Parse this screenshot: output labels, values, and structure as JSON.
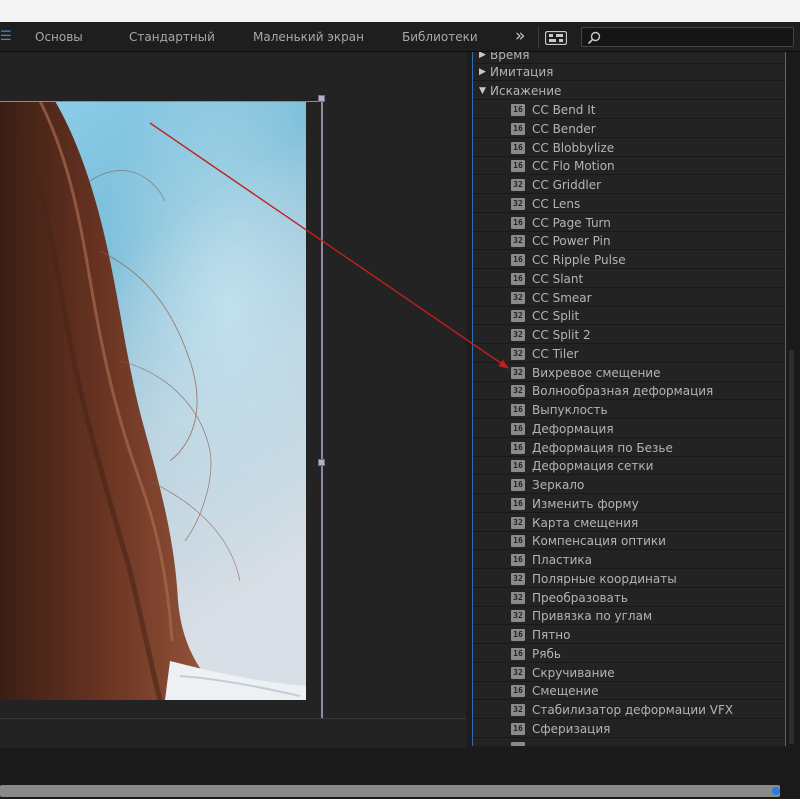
{
  "workspaces": {
    "menu_icon": "hamburger-icon",
    "items": [
      "Основы",
      "Стандартный",
      "Маленький экран",
      "Библиотеки"
    ],
    "overflow": "»",
    "accent": "#3d8ce0"
  },
  "search": {
    "placeholder": ""
  },
  "effects": {
    "folders_above": [
      {
        "label": "Время",
        "expanded": false
      },
      {
        "label": "Имитация",
        "expanded": false
      }
    ],
    "open_folder": {
      "label": "Искажение",
      "expanded": true
    },
    "items": [
      {
        "bits": "16",
        "label": "CC Bend It"
      },
      {
        "bits": "16",
        "label": "CC Bender"
      },
      {
        "bits": "16",
        "label": "CC Blobbylize"
      },
      {
        "bits": "16",
        "label": "CC Flo Motion"
      },
      {
        "bits": "32",
        "label": "CC Griddler"
      },
      {
        "bits": "32",
        "label": "CC Lens"
      },
      {
        "bits": "16",
        "label": "CC Page Turn"
      },
      {
        "bits": "32",
        "label": "CC Power Pin"
      },
      {
        "bits": "16",
        "label": "CC Ripple Pulse"
      },
      {
        "bits": "16",
        "label": "CC Slant"
      },
      {
        "bits": "32",
        "label": "CC Smear"
      },
      {
        "bits": "32",
        "label": "CC Split"
      },
      {
        "bits": "32",
        "label": "CC Split 2"
      },
      {
        "bits": "32",
        "label": "CC Tiler"
      },
      {
        "bits": "32",
        "label": "Вихревое смещение"
      },
      {
        "bits": "32",
        "label": "Волнообразная деформация"
      },
      {
        "bits": "16",
        "label": "Выпуклость"
      },
      {
        "bits": "16",
        "label": "Деформация"
      },
      {
        "bits": "16",
        "label": "Деформация по Безье"
      },
      {
        "bits": "16",
        "label": "Деформация сетки"
      },
      {
        "bits": "16",
        "label": "Зеркало"
      },
      {
        "bits": "16",
        "label": "Изменить форму"
      },
      {
        "bits": "32",
        "label": "Карта смещения"
      },
      {
        "bits": "16",
        "label": "Компенсация оптики"
      },
      {
        "bits": "16",
        "label": "Пластика"
      },
      {
        "bits": "32",
        "label": "Полярные координаты"
      },
      {
        "bits": "32",
        "label": "Преобразовать"
      },
      {
        "bits": "32",
        "label": "Привязка по углам"
      },
      {
        "bits": "16",
        "label": "Пятно"
      },
      {
        "bits": "16",
        "label": "Рябь"
      },
      {
        "bits": "32",
        "label": "Скручивание"
      },
      {
        "bits": "16",
        "label": "Смещение"
      },
      {
        "bits": "32",
        "label": "Стабилизатор деформации VFX"
      },
      {
        "bits": "16",
        "label": "Сферизация"
      }
    ]
  },
  "colors": {
    "arrow": "#c21f1f",
    "panel_border": "#2f6fb0",
    "timeline_marker": "#2a7be0"
  }
}
